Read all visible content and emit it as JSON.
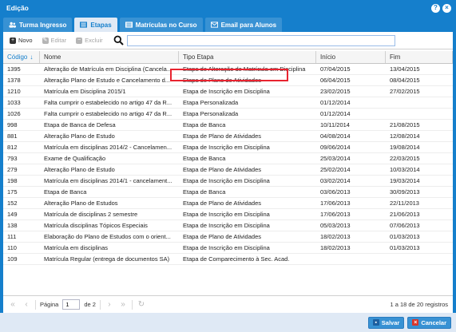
{
  "window": {
    "title": "Edição"
  },
  "tabs": [
    {
      "label": "Turma Ingresso",
      "active": false
    },
    {
      "label": "Etapas",
      "active": true
    },
    {
      "label": "Matrículas no Curso",
      "active": false
    },
    {
      "label": "Email para Alunos",
      "active": false
    }
  ],
  "toolbar": {
    "new_label": "Novo",
    "edit_label": "Editar",
    "delete_label": "Excluir",
    "search_value": ""
  },
  "grid": {
    "headers": [
      "Código",
      "Nome",
      "Tipo Etapa",
      "Início",
      "Fim"
    ],
    "rows": [
      [
        "1395",
        "Alteração de Matrícula em Disciplina (Cancela...",
        "Etapa de Alteração de Matrícula em Disciplina",
        "07/04/2015",
        "13/04/2015"
      ],
      [
        "1378",
        "Alteração Plano de Estudo e Cancelamento d...",
        "Etapa de Plano de Atividades",
        "06/04/2015",
        "08/04/2015"
      ],
      [
        "1210",
        "Matrícula em Disciplina 2015/1",
        "Etapa de Inscrição em Disciplina",
        "23/02/2015",
        "27/02/2015"
      ],
      [
        "1033",
        "Falta cumprir o estabelecido no artigo 47 da R...",
        "Etapa Personalizada",
        "01/12/2014",
        ""
      ],
      [
        "1026",
        "Falta cumprir o estabelecido no artigo 47 da R...",
        "Etapa Personalizada",
        "01/12/2014",
        ""
      ],
      [
        "998",
        "Etapa de Banca de Defesa",
        "Etapa de Banca",
        "10/11/2014",
        "21/08/2015"
      ],
      [
        "881",
        "Alteração Plano de Estudo",
        "Etapa de Plano de Atividades",
        "04/08/2014",
        "12/08/2014"
      ],
      [
        "812",
        "Matrícula em disciplinas 2014/2 - Cancelamen...",
        "Etapa de Inscrição em Disciplina",
        "09/06/2014",
        "19/08/2014"
      ],
      [
        "793",
        "Exame de Qualificação",
        "Etapa de Banca",
        "25/03/2014",
        "22/03/2015"
      ],
      [
        "279",
        "Alteração Plano de Estudo",
        "Etapa de Plano de Atividades",
        "25/02/2014",
        "10/03/2014"
      ],
      [
        "198",
        "Matrícula em disciplinas 2014/1 - cancelament...",
        "Etapa de Inscrição em Disciplina",
        "03/02/2014",
        "19/03/2014"
      ],
      [
        "175",
        "Etapa de Banca",
        "Etapa de Banca",
        "03/06/2013",
        "30/09/2013"
      ],
      [
        "152",
        "Alteração Plano de Estudos",
        "Etapa de Plano de Atividades",
        "17/06/2013",
        "22/11/2013"
      ],
      [
        "149",
        "Matrícula de disciplinas 2 semestre",
        "Etapa de Inscrição em Disciplina",
        "17/06/2013",
        "21/06/2013"
      ],
      [
        "138",
        "Matrícula disciplinas Tópicos Especiais",
        "Etapa de Inscrição em Disciplina",
        "05/03/2013",
        "07/06/2013"
      ],
      [
        "111",
        "Elaboração do Plano de Estudos com o orient...",
        "Etapa de Plano de Atividades",
        "18/02/2013",
        "01/03/2013"
      ],
      [
        "110",
        "Matrícula em disciplinas",
        "Etapa de Inscrição em Disciplina",
        "18/02/2013",
        "01/03/2013"
      ],
      [
        "109",
        "Matrícula Regular (entrega de documentos SA)",
        "Etapa de Comparecimento à Sec. Acad.",
        "",
        ""
      ]
    ]
  },
  "pager": {
    "page_label": "Página",
    "page_value": "1",
    "of_label": "de 2",
    "info": "1 a 18 de 20 registros"
  },
  "footer": {
    "save_label": "Salvar",
    "cancel_label": "Cancelar"
  },
  "colors": {
    "accent": "#157fcc",
    "highlight": "#e8232f"
  }
}
